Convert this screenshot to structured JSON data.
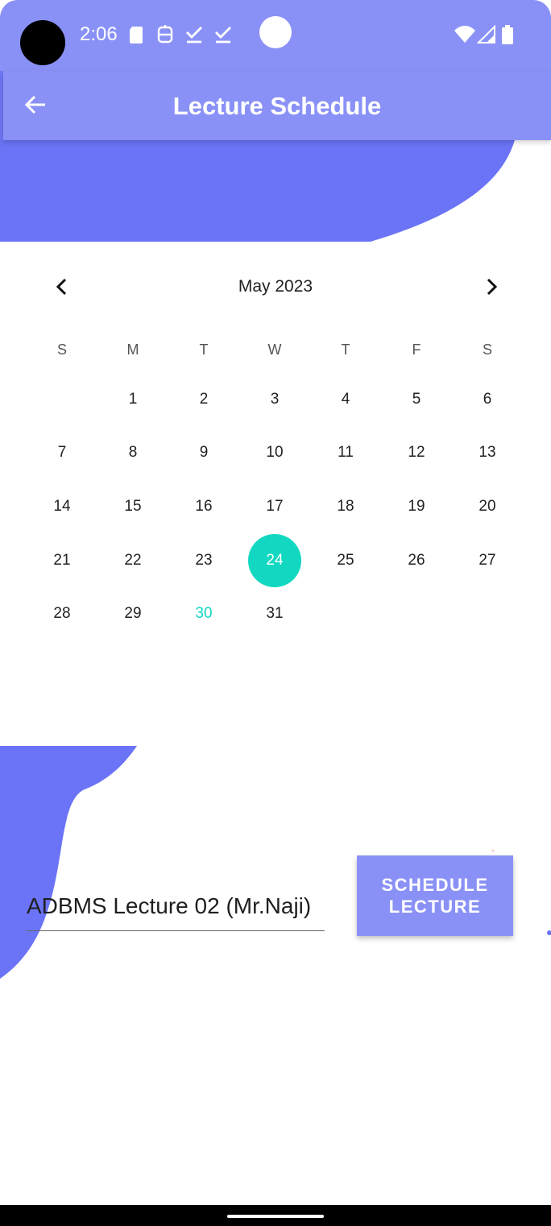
{
  "status_bar": {
    "time": "2:06",
    "left_icons": [
      "sd-card-icon",
      "storage-icon",
      "check-download-icon",
      "check-download-icon"
    ],
    "right_icons": [
      "wifi-icon",
      "signal-icon",
      "battery-icon"
    ]
  },
  "app_bar": {
    "title": "Lecture Schedule",
    "back_icon": "arrow-left-icon"
  },
  "calendar": {
    "month_label": "May 2023",
    "weekdays": [
      "S",
      "M",
      "T",
      "W",
      "T",
      "F",
      "S"
    ],
    "first_weekday_index": 1,
    "days_in_month": 31,
    "selected_day": 24,
    "today": 30,
    "selected_color": "#12d8c1",
    "prev_icon": "chevron-left-icon",
    "next_icon": "chevron-right-icon"
  },
  "form": {
    "lecture_name_value": "ADBMS Lecture 02 (Mr.Naji)",
    "schedule_button_label": "SCHEDULE LECTURE"
  },
  "colors": {
    "primary": "#8a91f6",
    "accent_shape": "#6b74f6",
    "highlight": "#12d8c1"
  }
}
